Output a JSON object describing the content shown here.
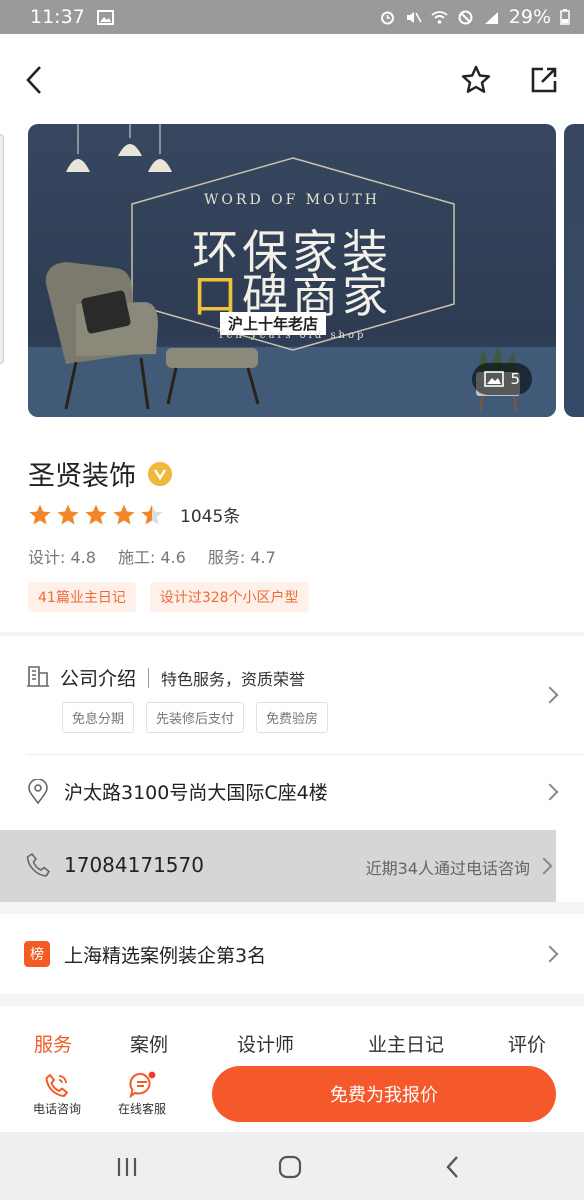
{
  "status_bar": {
    "time": "11:37",
    "battery": "29%"
  },
  "banner": {
    "line1": "WORD OF MOUTH",
    "line2": "环保家装",
    "line3_hl": "口",
    "line3_rest": "碑商家",
    "line4": "沪上十年老店",
    "line5": "Ten years old shop",
    "photo_count": "5"
  },
  "shop": {
    "name": "圣贤装饰",
    "rating": 4.5,
    "review_count": "1045条",
    "scores": [
      "设计: 4.8",
      "施工: 4.6",
      "服务: 4.7"
    ],
    "tags": [
      "41篇业主日记",
      "设计过328个小区户型"
    ]
  },
  "intro": {
    "title": "公司介绍",
    "subtitle": "特色服务，资质荣誉",
    "chips": [
      "免息分期",
      "先装修后支付",
      "免费验房"
    ]
  },
  "address": "沪太路3100号尚大国际C座4楼",
  "phone": {
    "number": "17084171570",
    "note": "近期34人通过电话咨询"
  },
  "rank": {
    "icon_text": "榜",
    "text": "上海精选案例装企第3名"
  },
  "tabs": [
    "服务",
    "案例",
    "设计师",
    "业主日记",
    "评价"
  ],
  "actions": {
    "call": "电话咨询",
    "chat": "在线客服",
    "quote": "免费为我报价"
  },
  "colors": {
    "accent": "#f25c24",
    "star": "#f4862a",
    "verified": "#f2b73a"
  }
}
